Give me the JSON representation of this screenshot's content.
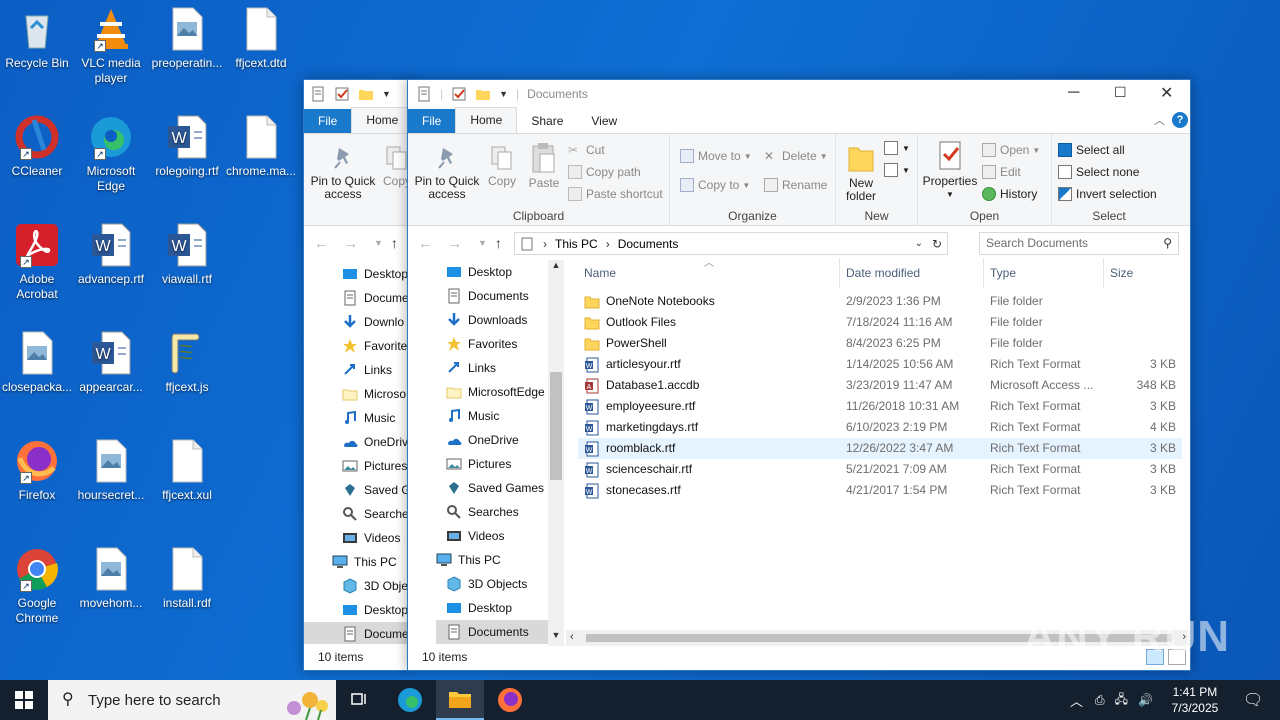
{
  "desktop": {
    "icons": [
      {
        "label": "Recycle Bin",
        "icon": "recycle-bin-icon"
      },
      {
        "label": "VLC media player",
        "icon": "vlc-icon"
      },
      {
        "label": "preoperatin...",
        "icon": "image-file-icon"
      },
      {
        "label": "ffjcext.dtd",
        "icon": "blank-file-icon"
      },
      {
        "label": "CCleaner",
        "icon": "ccleaner-icon"
      },
      {
        "label": "Microsoft Edge",
        "icon": "edge-icon"
      },
      {
        "label": "rolegoing.rtf",
        "icon": "word-icon"
      },
      {
        "label": "chrome.ma...",
        "icon": "blank-file-icon"
      },
      {
        "label": "Adobe Acrobat",
        "icon": "acrobat-icon"
      },
      {
        "label": "advancep.rtf",
        "icon": "word-icon"
      },
      {
        "label": "viawall.rtf",
        "icon": "word-icon"
      },
      {
        "label": "closepacka...",
        "icon": "image-file-icon"
      },
      {
        "label": "appearcar...",
        "icon": "word-icon"
      },
      {
        "label": "ffjcext.js",
        "icon": "script-icon"
      },
      {
        "label": "Firefox",
        "icon": "firefox-icon"
      },
      {
        "label": "hoursecret...",
        "icon": "image-file-icon"
      },
      {
        "label": "ffjcext.xul",
        "icon": "blank-file-icon"
      },
      {
        "label": "Google Chrome",
        "icon": "chrome-icon"
      },
      {
        "label": "movehom...",
        "icon": "image-file-icon"
      },
      {
        "label": "install.rdf",
        "icon": "blank-file-icon"
      }
    ]
  },
  "back_window": {
    "tabs": {
      "file": "File",
      "home": "Home"
    },
    "ribbon": {
      "pin": "Pin to Quick access",
      "copy": "Copy"
    },
    "tree": [
      "Desktop",
      "Docume",
      "Downlo",
      "Favorite",
      "Links",
      "Microso",
      "Music",
      "OneDriv",
      "Pictures",
      "Saved G",
      "Searches",
      "Videos",
      "This PC",
      "3D Obje",
      "Desktop",
      "Docume"
    ],
    "status": "10 items"
  },
  "window": {
    "title": "Documents",
    "tabs": {
      "file": "File",
      "home": "Home",
      "share": "Share",
      "view": "View"
    },
    "ribbon": {
      "pin": "Pin to Quick access",
      "copy": "Copy",
      "paste": "Paste",
      "cut": "Cut",
      "copy_path": "Copy path",
      "paste_shortcut": "Paste shortcut",
      "clipboard": "Clipboard",
      "move_to": "Move to",
      "copy_to": "Copy to",
      "delete": "Delete",
      "rename": "Rename",
      "organize": "Organize",
      "new_folder": "New folder",
      "new": "New",
      "properties": "Properties",
      "open_btn": "Open",
      "edit": "Edit",
      "history": "History",
      "open": "Open",
      "select_all": "Select all",
      "select_none": "Select none",
      "invert_selection": "Invert selection",
      "select": "Select"
    },
    "address": {
      "this_pc": "This PC",
      "documents": "Documents"
    },
    "search_placeholder": "Search Documents",
    "tree": [
      "Desktop",
      "Documents",
      "Downloads",
      "Favorites",
      "Links",
      "MicrosoftEdge",
      "Music",
      "OneDrive",
      "Pictures",
      "Saved Games",
      "Searches",
      "Videos",
      "This PC",
      "3D Objects",
      "Desktop",
      "Documents"
    ],
    "columns": {
      "name": "Name",
      "date": "Date modified",
      "type": "Type",
      "size": "Size"
    },
    "files": [
      {
        "name": "OneNote Notebooks",
        "date": "2/9/2023 1:36 PM",
        "type": "File folder",
        "size": "",
        "icon": "folder"
      },
      {
        "name": "Outlook Files",
        "date": "7/18/2024 11:16 AM",
        "type": "File folder",
        "size": "",
        "icon": "folder"
      },
      {
        "name": "PowerShell",
        "date": "8/4/2023 6:25 PM",
        "type": "File folder",
        "size": "",
        "icon": "folder"
      },
      {
        "name": "articlesyour.rtf",
        "date": "1/14/2025 10:56 AM",
        "type": "Rich Text Format",
        "size": "3 KB",
        "icon": "rtf"
      },
      {
        "name": "Database1.accdb",
        "date": "3/23/2019 11:47 AM",
        "type": "Microsoft Access ...",
        "size": "348 KB",
        "icon": "access"
      },
      {
        "name": "employeesure.rtf",
        "date": "11/26/2018 10:31 AM",
        "type": "Rich Text Format",
        "size": "3 KB",
        "icon": "rtf"
      },
      {
        "name": "marketingdays.rtf",
        "date": "6/10/2023 2:19 PM",
        "type": "Rich Text Format",
        "size": "4 KB",
        "icon": "rtf"
      },
      {
        "name": "roomblack.rtf",
        "date": "12/26/2022 3:47 AM",
        "type": "Rich Text Format",
        "size": "3 KB",
        "icon": "rtf"
      },
      {
        "name": "scienceschair.rtf",
        "date": "5/21/2021 7:09 AM",
        "type": "Rich Text Format",
        "size": "3 KB",
        "icon": "rtf"
      },
      {
        "name": "stonecases.rtf",
        "date": "4/21/2017 1:54 PM",
        "type": "Rich Text Format",
        "size": "3 KB",
        "icon": "rtf"
      }
    ],
    "status": "10 items"
  },
  "taskbar": {
    "search_placeholder": "Type here to search",
    "time": "1:41 PM",
    "date": "7/3/2025"
  },
  "watermark": "ANY RUN",
  "colors": {
    "accent": "#1979ca",
    "selection": "#cce8ff",
    "taskbar": "#14202e"
  }
}
